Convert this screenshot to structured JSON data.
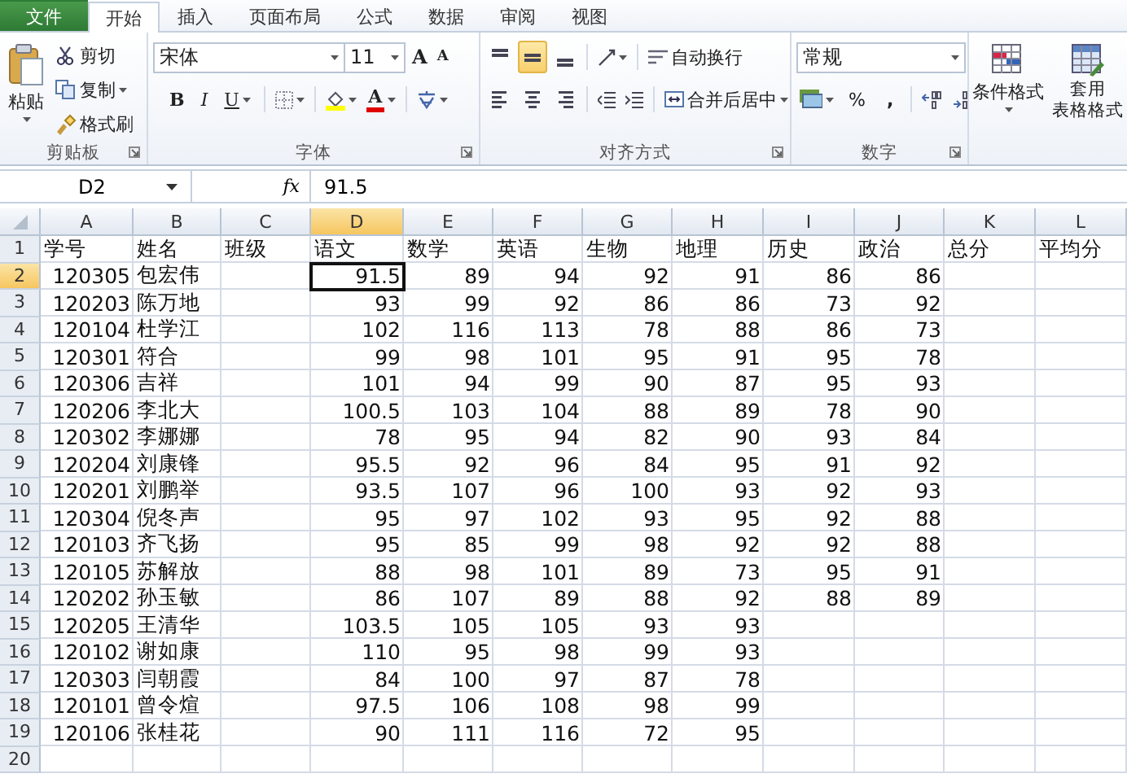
{
  "tabs": [
    {
      "label": "文件",
      "kind": "file",
      "selected": false
    },
    {
      "label": "开始",
      "kind": "tab",
      "selected": true
    },
    {
      "label": "插入",
      "kind": "tab",
      "selected": false
    },
    {
      "label": "页面布局",
      "kind": "tab",
      "selected": false
    },
    {
      "label": "公式",
      "kind": "tab",
      "selected": false
    },
    {
      "label": "数据",
      "kind": "tab",
      "selected": false
    },
    {
      "label": "审阅",
      "kind": "tab",
      "selected": false
    },
    {
      "label": "视图",
      "kind": "tab",
      "selected": false
    }
  ],
  "ribbon": {
    "clipboard": {
      "paste": "粘贴",
      "items": [
        {
          "label": "剪切",
          "kind": "cut",
          "dropdown": false
        },
        {
          "label": "复制",
          "kind": "copy",
          "dropdown": true
        },
        {
          "label": "格式刷",
          "kind": "format_painter",
          "dropdown": false
        }
      ],
      "group_label": "剪贴板"
    },
    "font": {
      "font_name": "宋体",
      "font_size": "11",
      "grow": "A",
      "shrink": "A",
      "styles": [
        {
          "label": "B",
          "kind": "bold"
        },
        {
          "label": "I",
          "kind": "italic"
        },
        {
          "label": "U",
          "kind": "underline"
        }
      ],
      "font_color": "A",
      "group_label": "字体"
    },
    "alignment": {
      "vertical": [
        {
          "kind": "top",
          "selected": false
        },
        {
          "kind": "middle",
          "selected": true
        },
        {
          "kind": "bottom",
          "selected": false
        }
      ],
      "horizontal": [
        {
          "kind": "left",
          "selected": false
        },
        {
          "kind": "center",
          "selected": false
        },
        {
          "kind": "right",
          "selected": false
        }
      ],
      "wrap_text": "自动换行",
      "merge_center": "合并后居中",
      "group_label": "对齐方式"
    },
    "number": {
      "format": "常规",
      "percent": "%",
      "comma": ",",
      "group_label": "数字"
    },
    "styles": {
      "conditional_formatting": "条件格式",
      "format_as_table": [
        "套用",
        "表格格式"
      ]
    }
  },
  "formula_bar": {
    "name_box": "D2",
    "fx": "fx",
    "formula": "91.5"
  },
  "sheet": {
    "columns": [
      {
        "label": "A",
        "selected": false
      },
      {
        "label": "B",
        "selected": false
      },
      {
        "label": "C",
        "selected": false
      },
      {
        "label": "D",
        "selected": true
      },
      {
        "label": "E",
        "selected": false
      },
      {
        "label": "F",
        "selected": false
      },
      {
        "label": "G",
        "selected": false
      },
      {
        "label": "H",
        "selected": false
      },
      {
        "label": "I",
        "selected": false
      },
      {
        "label": "J",
        "selected": false
      },
      {
        "label": "K",
        "selected": false
      },
      {
        "label": "L",
        "selected": false
      }
    ],
    "rows": [
      {
        "number": "1",
        "selected": false,
        "cells": {
          "A": "学号",
          "B": "姓名",
          "C": "班级",
          "D": "语文",
          "E": "数学",
          "F": "英语",
          "G": "生物",
          "H": "地理",
          "I": "历史",
          "J": "政治",
          "K": "总分",
          "L": "平均分"
        }
      },
      {
        "number": "2",
        "selected": true,
        "cells": {
          "A": "120305",
          "B": "包宏伟",
          "D": "91.5",
          "E": "89",
          "F": "94",
          "G": "92",
          "H": "91",
          "I": "86",
          "J": "86"
        }
      },
      {
        "number": "3",
        "selected": false,
        "cells": {
          "A": "120203",
          "B": "陈万地",
          "D": "93",
          "E": "99",
          "F": "92",
          "G": "86",
          "H": "86",
          "I": "73",
          "J": "92"
        }
      },
      {
        "number": "4",
        "selected": false,
        "cells": {
          "A": "120104",
          "B": "杜学江",
          "D": "102",
          "E": "116",
          "F": "113",
          "G": "78",
          "H": "88",
          "I": "86",
          "J": "73"
        }
      },
      {
        "number": "5",
        "selected": false,
        "cells": {
          "A": "120301",
          "B": "符合",
          "D": "99",
          "E": "98",
          "F": "101",
          "G": "95",
          "H": "91",
          "I": "95",
          "J": "78"
        }
      },
      {
        "number": "6",
        "selected": false,
        "cells": {
          "A": "120306",
          "B": "吉祥",
          "D": "101",
          "E": "94",
          "F": "99",
          "G": "90",
          "H": "87",
          "I": "95",
          "J": "93"
        }
      },
      {
        "number": "7",
        "selected": false,
        "cells": {
          "A": "120206",
          "B": "李北大",
          "D": "100.5",
          "E": "103",
          "F": "104",
          "G": "88",
          "H": "89",
          "I": "78",
          "J": "90"
        }
      },
      {
        "number": "8",
        "selected": false,
        "cells": {
          "A": "120302",
          "B": "李娜娜",
          "D": "78",
          "E": "95",
          "F": "94",
          "G": "82",
          "H": "90",
          "I": "93",
          "J": "84"
        }
      },
      {
        "number": "9",
        "selected": false,
        "cells": {
          "A": "120204",
          "B": "刘康锋",
          "D": "95.5",
          "E": "92",
          "F": "96",
          "G": "84",
          "H": "95",
          "I": "91",
          "J": "92"
        }
      },
      {
        "number": "10",
        "selected": false,
        "cells": {
          "A": "120201",
          "B": "刘鹏举",
          "D": "93.5",
          "E": "107",
          "F": "96",
          "G": "100",
          "H": "93",
          "I": "92",
          "J": "93"
        }
      },
      {
        "number": "11",
        "selected": false,
        "cells": {
          "A": "120304",
          "B": "倪冬声",
          "D": "95",
          "E": "97",
          "F": "102",
          "G": "93",
          "H": "95",
          "I": "92",
          "J": "88"
        }
      },
      {
        "number": "12",
        "selected": false,
        "cells": {
          "A": "120103",
          "B": "齐飞扬",
          "D": "95",
          "E": "85",
          "F": "99",
          "G": "98",
          "H": "92",
          "I": "92",
          "J": "88"
        }
      },
      {
        "number": "13",
        "selected": false,
        "cells": {
          "A": "120105",
          "B": "苏解放",
          "D": "88",
          "E": "98",
          "F": "101",
          "G": "89",
          "H": "73",
          "I": "95",
          "J": "91"
        }
      },
      {
        "number": "14",
        "selected": false,
        "cells": {
          "A": "120202",
          "B": "孙玉敏",
          "D": "86",
          "E": "107",
          "F": "89",
          "G": "88",
          "H": "92",
          "I": "88",
          "J": "89"
        }
      },
      {
        "number": "15",
        "selected": false,
        "cells": {
          "A": "120205",
          "B": "王清华",
          "D": "103.5",
          "E": "105",
          "F": "105",
          "G": "93",
          "H": "93"
        }
      },
      {
        "number": "16",
        "selected": false,
        "cells": {
          "A": "120102",
          "B": "谢如康",
          "D": "110",
          "E": "95",
          "F": "98",
          "G": "99",
          "H": "93"
        }
      },
      {
        "number": "17",
        "selected": false,
        "cells": {
          "A": "120303",
          "B": "闫朝霞",
          "D": "84",
          "E": "100",
          "F": "97",
          "G": "87",
          "H": "78"
        }
      },
      {
        "number": "18",
        "selected": false,
        "cells": {
          "A": "120101",
          "B": "曾令煊",
          "D": "97.5",
          "E": "106",
          "F": "108",
          "G": "98",
          "H": "99"
        }
      },
      {
        "number": "19",
        "selected": false,
        "cells": {
          "A": "120106",
          "B": "张桂花",
          "D": "90",
          "E": "111",
          "F": "116",
          "G": "72",
          "H": "95"
        }
      },
      {
        "number": "20",
        "selected": false
      }
    ]
  }
}
